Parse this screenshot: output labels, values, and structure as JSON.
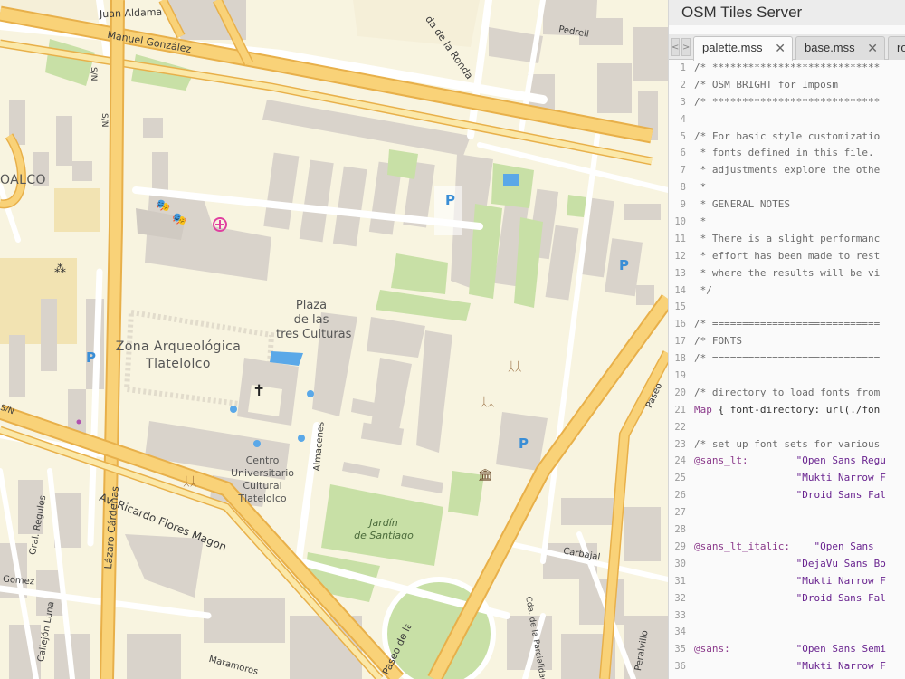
{
  "map": {
    "streets": [
      "Juan Aldama",
      "Manuel González",
      "Pedrell",
      "da de la Ronda",
      "S/N",
      "S/N",
      "S/N",
      "Av. Ricardo Flores Magon",
      "Lázaro Cárdenas",
      "Gral. Regules",
      "Almacenes",
      "Carbajal",
      "Gomez",
      "Callejón Luna",
      "Matamoros",
      "Paseo",
      "Cda. de la Parcialidad",
      "Peralvillo",
      "Paseo de la Reforma"
    ],
    "areas": {
      "partial_label": "OALCO",
      "plaza": [
        "Plaza",
        "de las",
        "tres Culturas"
      ],
      "zona": [
        "Zona Arqueológica",
        "Tlatelolco"
      ],
      "centro": [
        "Centro",
        "Universitario",
        "Cultural",
        "Tlatelolco"
      ],
      "jardin": [
        "Jardín",
        "de Santiago"
      ]
    },
    "parking_symbol": "P",
    "icons": [
      "theatre-icon",
      "hospital-icon",
      "church-icon",
      "playground-icon",
      "museum-icon",
      "parking-icon"
    ]
  },
  "editor": {
    "title": "OSM Tiles Server",
    "tab_prev": "<",
    "tab_next": ">",
    "tabs": [
      {
        "label": "palette.mss",
        "active": true
      },
      {
        "label": "base.mss",
        "active": false
      },
      {
        "label": "ro",
        "active": false
      }
    ],
    "close_symbol": "✕",
    "lines": [
      {
        "n": "1",
        "parts": [
          {
            "t": "/* ****************************",
            "c": "comment"
          }
        ]
      },
      {
        "n": "2",
        "parts": [
          {
            "t": "/* OSM BRIGHT for Imposm",
            "c": "comment"
          }
        ]
      },
      {
        "n": "3",
        "parts": [
          {
            "t": "/* ****************************",
            "c": "comment"
          }
        ]
      },
      {
        "n": "4",
        "parts": []
      },
      {
        "n": "5",
        "parts": [
          {
            "t": "/* For basic style customizatio",
            "c": "comment"
          }
        ]
      },
      {
        "n": "6",
        "parts": [
          {
            "t": " * fonts defined in this file.",
            "c": "comment"
          }
        ]
      },
      {
        "n": "7",
        "parts": [
          {
            "t": " * adjustments explore the othe",
            "c": "comment"
          }
        ]
      },
      {
        "n": "8",
        "parts": [
          {
            "t": " *",
            "c": "comment"
          }
        ]
      },
      {
        "n": "9",
        "parts": [
          {
            "t": " * GENERAL NOTES",
            "c": "comment"
          }
        ]
      },
      {
        "n": "10",
        "parts": [
          {
            "t": " *",
            "c": "comment"
          }
        ]
      },
      {
        "n": "11",
        "parts": [
          {
            "t": " * There is a slight performanc",
            "c": "comment"
          }
        ]
      },
      {
        "n": "12",
        "parts": [
          {
            "t": " * effort has been made to rest",
            "c": "comment"
          }
        ]
      },
      {
        "n": "13",
        "parts": [
          {
            "t": " * where the results will be vi",
            "c": "comment"
          }
        ]
      },
      {
        "n": "14",
        "parts": [
          {
            "t": " */",
            "c": "comment"
          }
        ]
      },
      {
        "n": "15",
        "parts": []
      },
      {
        "n": "16",
        "parts": [
          {
            "t": "/* ============================",
            "c": "comment"
          }
        ]
      },
      {
        "n": "17",
        "parts": [
          {
            "t": "/* FONTS",
            "c": "comment"
          }
        ]
      },
      {
        "n": "18",
        "parts": [
          {
            "t": "/* ============================",
            "c": "comment"
          }
        ]
      },
      {
        "n": "19",
        "parts": []
      },
      {
        "n": "20",
        "parts": [
          {
            "t": "/* directory to load fonts from",
            "c": "comment"
          }
        ]
      },
      {
        "n": "21",
        "parts": [
          {
            "t": "Map",
            "c": "kw"
          },
          {
            "t": " { font-directory: url(./fon",
            "c": "normal"
          }
        ]
      },
      {
        "n": "22",
        "parts": []
      },
      {
        "n": "23",
        "parts": [
          {
            "t": "/* set up font sets for various",
            "c": "comment"
          }
        ]
      },
      {
        "n": "24",
        "parts": [
          {
            "t": "@sans_lt:",
            "c": "kw"
          },
          {
            "t": "        \"Open Sans Regu",
            "c": "str"
          }
        ]
      },
      {
        "n": "25",
        "parts": [
          {
            "t": "                 \"Mukti Narrow F",
            "c": "str"
          }
        ]
      },
      {
        "n": "26",
        "parts": [
          {
            "t": "                 \"Droid Sans Fal",
            "c": "str"
          }
        ]
      },
      {
        "n": "27",
        "parts": []
      },
      {
        "n": "28",
        "parts": []
      },
      {
        "n": "29",
        "parts": [
          {
            "t": "@sans_lt_italic:",
            "c": "kw"
          },
          {
            "t": "    \"Open Sans ",
            "c": "str"
          }
        ]
      },
      {
        "n": "30",
        "parts": [
          {
            "t": "                 \"DejaVu Sans Bo",
            "c": "str"
          }
        ]
      },
      {
        "n": "31",
        "parts": [
          {
            "t": "                 \"Mukti Narrow F",
            "c": "str"
          }
        ]
      },
      {
        "n": "32",
        "parts": [
          {
            "t": "                 \"Droid Sans Fal",
            "c": "str"
          }
        ]
      },
      {
        "n": "33",
        "parts": []
      },
      {
        "n": "34",
        "parts": []
      },
      {
        "n": "35",
        "parts": [
          {
            "t": "@sans:",
            "c": "kw"
          },
          {
            "t": "           \"Open Sans Semi",
            "c": "str"
          }
        ]
      },
      {
        "n": "36",
        "parts": [
          {
            "t": "                 \"Mukti Narrow F",
            "c": "str"
          }
        ]
      }
    ]
  },
  "colors": {
    "map_bg": "#f8f4e0",
    "building": "#d9d3cb",
    "major_road": "#f7c55e",
    "park": "#c8e0a6",
    "water": "#5aa8e8",
    "parking": "#3a8ed6"
  }
}
